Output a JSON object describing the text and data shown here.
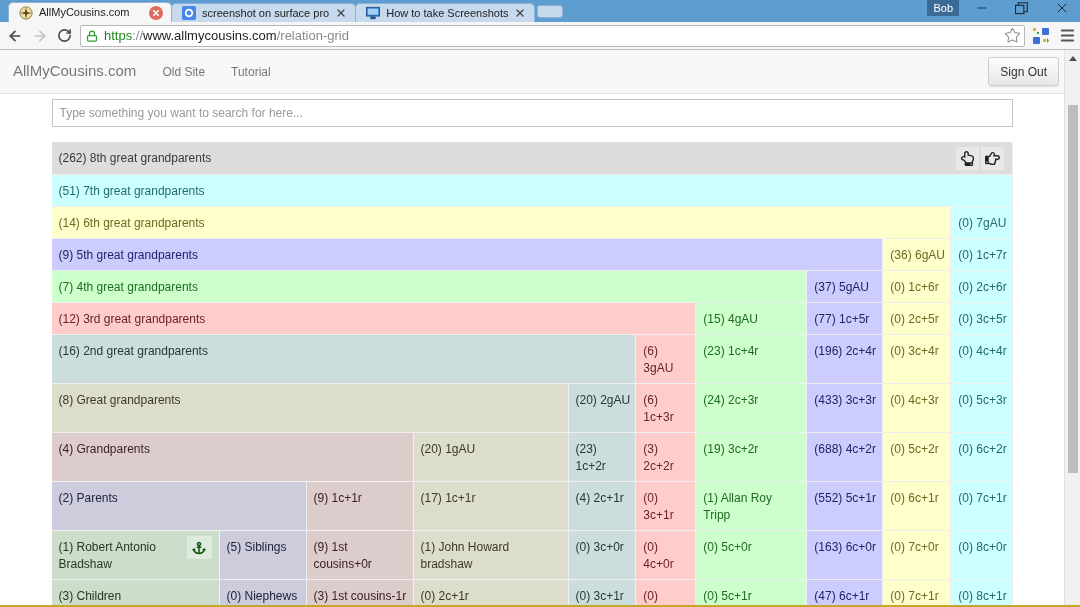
{
  "browser": {
    "tabs": [
      {
        "title": "AllMyCousins.com",
        "selected": true
      },
      {
        "title": "screenshot on surface pro",
        "selected": false
      },
      {
        "title": "How to take Screenshots",
        "selected": false
      }
    ],
    "profile": "Bob",
    "url": {
      "scheme": "https",
      "separator": "://",
      "host": "www.allmycousins.com",
      "path": "/relation-grid"
    }
  },
  "navbar": {
    "brand": "AllMyCousins.com",
    "links": [
      "Old Site",
      "Tutorial"
    ],
    "sign_out": "Sign Out"
  },
  "search": {
    "placeholder": "Type something you want to search for here..."
  },
  "grid": {
    "rows": [
      {
        "cells": [
          {
            "text": "(262) 8th great grandparents",
            "color": "#dddddd",
            "colspan": 10
          }
        ]
      },
      {
        "cells": [
          {
            "text": "(51) 7th great grandparents",
            "color": "#ccffff",
            "colspan": 10
          }
        ]
      },
      {
        "cells": [
          {
            "text": "(14) 6th great grandparents",
            "color": "#ffffcc",
            "colspan": 9
          },
          {
            "text": "(0) 7gAU",
            "color": "#ccffff"
          }
        ]
      },
      {
        "cells": [
          {
            "text": "(9) 5th great grandparents",
            "color": "#ccccff",
            "colspan": 8
          },
          {
            "text": "(36) 6gAU",
            "color": "#ffffcc"
          },
          {
            "text": "(0) 1c+7r",
            "color": "#ccffff"
          }
        ]
      },
      {
        "cells": [
          {
            "text": "(7) 4th great grandparents",
            "color": "#ccffcc",
            "colspan": 7
          },
          {
            "text": "(37) 5gAU",
            "color": "#ccccff"
          },
          {
            "text": "(0) 1c+6r",
            "color": "#ffffcc"
          },
          {
            "text": "(0) 2c+6r",
            "color": "#ccffff"
          }
        ]
      },
      {
        "cells": [
          {
            "text": "(12) 3rd great grandparents",
            "color": "#ffcccc",
            "colspan": 6
          },
          {
            "text": "(15) 4gAU",
            "color": "#ccffcc"
          },
          {
            "text": "(77) 1c+5r",
            "color": "#ccccff"
          },
          {
            "text": "(0) 2c+5r",
            "color": "#ffffcc"
          },
          {
            "text": "(0) 3c+5r",
            "color": "#ccffff"
          }
        ]
      },
      {
        "cells": [
          {
            "text": "(16) 2nd great grandparents",
            "color": "#ccdddd",
            "colspan": 5
          },
          {
            "text": "(6) 3gAU",
            "color": "#ffcccc"
          },
          {
            "text": "(23) 1c+4r",
            "color": "#ccffcc"
          },
          {
            "text": "(196) 2c+4r",
            "color": "#ccccff"
          },
          {
            "text": "(0) 3c+4r",
            "color": "#ffffcc"
          },
          {
            "text": "(0) 4c+4r",
            "color": "#ccffff"
          }
        ]
      },
      {
        "cells": [
          {
            "text": "(8) Great grandparents",
            "color": "#ddddcc",
            "colspan": 4
          },
          {
            "text": "(20) 2gAU",
            "color": "#ccdddd"
          },
          {
            "text": "(6) 1c+3r",
            "color": "#ffcccc"
          },
          {
            "text": "(24) 2c+3r",
            "color": "#ccffcc"
          },
          {
            "text": "(433) 3c+3r",
            "color": "#ccccff"
          },
          {
            "text": "(0) 4c+3r",
            "color": "#ffffcc"
          },
          {
            "text": "(0) 5c+3r",
            "color": "#ccffff"
          }
        ]
      },
      {
        "cells": [
          {
            "text": "(4) Grandparents",
            "color": "#ddcccc",
            "colspan": 3
          },
          {
            "text": "(20) 1gAU",
            "color": "#ddddcc"
          },
          {
            "text": "(23) 1c+2r",
            "color": "#ccdddd"
          },
          {
            "text": "(3) 2c+2r",
            "color": "#ffcccc"
          },
          {
            "text": "(19) 3c+2r",
            "color": "#ccffcc"
          },
          {
            "text": "(688) 4c+2r",
            "color": "#ccccff"
          },
          {
            "text": "(0) 5c+2r",
            "color": "#ffffcc"
          },
          {
            "text": "(0) 6c+2r",
            "color": "#ccffff"
          }
        ]
      },
      {
        "cells": [
          {
            "text": "(2) Parents",
            "color": "#ccccdd",
            "colspan": 2
          },
          {
            "text": "(9) 1c+1r",
            "color": "#ddcccc"
          },
          {
            "text": "(17) 1c+1r",
            "color": "#ddddcc"
          },
          {
            "text": "(4) 2c+1r",
            "color": "#ccdddd"
          },
          {
            "text": "(0) 3c+1r",
            "color": "#ffcccc"
          },
          {
            "text": "(1) Allan Roy Tripp",
            "color": "#ccffcc"
          },
          {
            "text": "(552) 5c+1r",
            "color": "#ccccff"
          },
          {
            "text": "(0) 6c+1r",
            "color": "#ffffcc"
          },
          {
            "text": "(0) 7c+1r",
            "color": "#ccffff"
          }
        ]
      },
      {
        "cells": [
          {
            "text": "(1) Robert Antonio Bradshaw",
            "color": "#ccddcc",
            "anchored": true
          },
          {
            "text": "(5) Siblings",
            "color": "#ccccdd"
          },
          {
            "text": "(9) 1st cousins+0r",
            "color": "#ddcccc"
          },
          {
            "text": "(1) John Howard bradshaw",
            "color": "#ddddcc"
          },
          {
            "text": "(0) 3c+0r",
            "color": "#ccdddd"
          },
          {
            "text": "(0) 4c+0r",
            "color": "#ffcccc"
          },
          {
            "text": "(0) 5c+0r",
            "color": "#ccffcc"
          },
          {
            "text": "(163) 6c+0r",
            "color": "#ccccff"
          },
          {
            "text": "(0) 7c+0r",
            "color": "#ffffcc"
          },
          {
            "text": "(0) 8c+0r",
            "color": "#ccffff"
          }
        ]
      },
      {
        "cells": [
          {
            "text": "(3) Children",
            "color": "#ccddcc"
          },
          {
            "text": "(0) Niephews",
            "color": "#ccccdd"
          },
          {
            "text": "(3) 1st cousins-1r",
            "color": "#ddcccc"
          },
          {
            "text": "(0) 2c+1r",
            "color": "#ddddcc"
          },
          {
            "text": "(0) 3c+1r",
            "color": "#ccdddd"
          },
          {
            "text": "(0)",
            "color": "#ffcccc"
          },
          {
            "text": "(0) 5c+1r",
            "color": "#ccffcc"
          },
          {
            "text": "(47) 6c+1r",
            "color": "#ccccff"
          },
          {
            "text": "(0) 7c+1r",
            "color": "#ffffcc"
          },
          {
            "text": "(0) 8c+1r",
            "color": "#ccffff"
          }
        ]
      }
    ]
  }
}
